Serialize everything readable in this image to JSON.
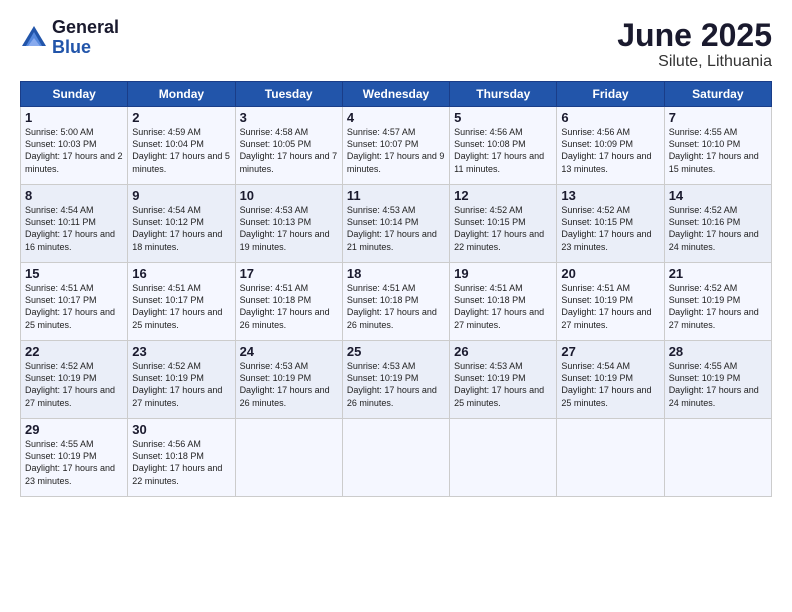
{
  "logo": {
    "general": "General",
    "blue": "Blue"
  },
  "title": "June 2025",
  "subtitle": "Silute, Lithuania",
  "headers": [
    "Sunday",
    "Monday",
    "Tuesday",
    "Wednesday",
    "Thursday",
    "Friday",
    "Saturday"
  ],
  "weeks": [
    [
      {
        "day": "1",
        "sunrise": "5:00 AM",
        "sunset": "10:03 PM",
        "daylight": "17 hours and 2 minutes."
      },
      {
        "day": "2",
        "sunrise": "4:59 AM",
        "sunset": "10:04 PM",
        "daylight": "17 hours and 5 minutes."
      },
      {
        "day": "3",
        "sunrise": "4:58 AM",
        "sunset": "10:05 PM",
        "daylight": "17 hours and 7 minutes."
      },
      {
        "day": "4",
        "sunrise": "4:57 AM",
        "sunset": "10:07 PM",
        "daylight": "17 hours and 9 minutes."
      },
      {
        "day": "5",
        "sunrise": "4:56 AM",
        "sunset": "10:08 PM",
        "daylight": "17 hours and 11 minutes."
      },
      {
        "day": "6",
        "sunrise": "4:56 AM",
        "sunset": "10:09 PM",
        "daylight": "17 hours and 13 minutes."
      },
      {
        "day": "7",
        "sunrise": "4:55 AM",
        "sunset": "10:10 PM",
        "daylight": "17 hours and 15 minutes."
      }
    ],
    [
      {
        "day": "8",
        "sunrise": "4:54 AM",
        "sunset": "10:11 PM",
        "daylight": "17 hours and 16 minutes."
      },
      {
        "day": "9",
        "sunrise": "4:54 AM",
        "sunset": "10:12 PM",
        "daylight": "17 hours and 18 minutes."
      },
      {
        "day": "10",
        "sunrise": "4:53 AM",
        "sunset": "10:13 PM",
        "daylight": "17 hours and 19 minutes."
      },
      {
        "day": "11",
        "sunrise": "4:53 AM",
        "sunset": "10:14 PM",
        "daylight": "17 hours and 21 minutes."
      },
      {
        "day": "12",
        "sunrise": "4:52 AM",
        "sunset": "10:15 PM",
        "daylight": "17 hours and 22 minutes."
      },
      {
        "day": "13",
        "sunrise": "4:52 AM",
        "sunset": "10:15 PM",
        "daylight": "17 hours and 23 minutes."
      },
      {
        "day": "14",
        "sunrise": "4:52 AM",
        "sunset": "10:16 PM",
        "daylight": "17 hours and 24 minutes."
      }
    ],
    [
      {
        "day": "15",
        "sunrise": "4:51 AM",
        "sunset": "10:17 PM",
        "daylight": "17 hours and 25 minutes."
      },
      {
        "day": "16",
        "sunrise": "4:51 AM",
        "sunset": "10:17 PM",
        "daylight": "17 hours and 25 minutes."
      },
      {
        "day": "17",
        "sunrise": "4:51 AM",
        "sunset": "10:18 PM",
        "daylight": "17 hours and 26 minutes."
      },
      {
        "day": "18",
        "sunrise": "4:51 AM",
        "sunset": "10:18 PM",
        "daylight": "17 hours and 26 minutes."
      },
      {
        "day": "19",
        "sunrise": "4:51 AM",
        "sunset": "10:18 PM",
        "daylight": "17 hours and 27 minutes."
      },
      {
        "day": "20",
        "sunrise": "4:51 AM",
        "sunset": "10:19 PM",
        "daylight": "17 hours and 27 minutes."
      },
      {
        "day": "21",
        "sunrise": "4:52 AM",
        "sunset": "10:19 PM",
        "daylight": "17 hours and 27 minutes."
      }
    ],
    [
      {
        "day": "22",
        "sunrise": "4:52 AM",
        "sunset": "10:19 PM",
        "daylight": "17 hours and 27 minutes."
      },
      {
        "day": "23",
        "sunrise": "4:52 AM",
        "sunset": "10:19 PM",
        "daylight": "17 hours and 27 minutes."
      },
      {
        "day": "24",
        "sunrise": "4:53 AM",
        "sunset": "10:19 PM",
        "daylight": "17 hours and 26 minutes."
      },
      {
        "day": "25",
        "sunrise": "4:53 AM",
        "sunset": "10:19 PM",
        "daylight": "17 hours and 26 minutes."
      },
      {
        "day": "26",
        "sunrise": "4:53 AM",
        "sunset": "10:19 PM",
        "daylight": "17 hours and 25 minutes."
      },
      {
        "day": "27",
        "sunrise": "4:54 AM",
        "sunset": "10:19 PM",
        "daylight": "17 hours and 25 minutes."
      },
      {
        "day": "28",
        "sunrise": "4:55 AM",
        "sunset": "10:19 PM",
        "daylight": "17 hours and 24 minutes."
      }
    ],
    [
      {
        "day": "29",
        "sunrise": "4:55 AM",
        "sunset": "10:19 PM",
        "daylight": "17 hours and 23 minutes."
      },
      {
        "day": "30",
        "sunrise": "4:56 AM",
        "sunset": "10:18 PM",
        "daylight": "17 hours and 22 minutes."
      },
      null,
      null,
      null,
      null,
      null
    ]
  ]
}
